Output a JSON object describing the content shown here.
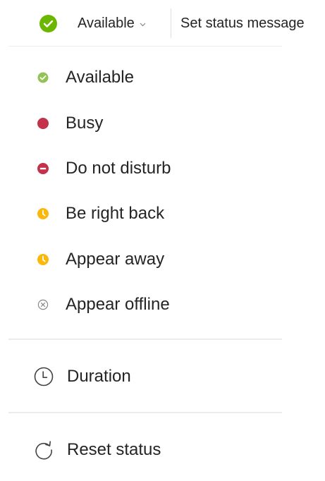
{
  "header": {
    "current_status": "Available",
    "set_status_message": "Set status message"
  },
  "status_options": [
    {
      "label": "Available",
      "icon": "available-check-icon",
      "color": "#92c353"
    },
    {
      "label": "Busy",
      "icon": "busy-dot-icon",
      "color": "#c4314b"
    },
    {
      "label": "Do not disturb",
      "icon": "do-not-disturb-icon",
      "color": "#c4314b"
    },
    {
      "label": "Be right back",
      "icon": "clock-away-icon",
      "color": "#fcb80a"
    },
    {
      "label": "Appear away",
      "icon": "clock-away-icon",
      "color": "#fcb80a"
    },
    {
      "label": "Appear offline",
      "icon": "offline-x-icon",
      "color": "#8a8886"
    }
  ],
  "actions": {
    "duration": {
      "label": "Duration",
      "icon": "clock-icon"
    },
    "reset": {
      "label": "Reset status",
      "icon": "refresh-icon"
    }
  },
  "colors": {
    "text": "#252423",
    "divider": "#ebebeb",
    "available": "#92c353",
    "busy": "#c4314b",
    "away": "#fcb80a",
    "offline": "#8a8886"
  }
}
